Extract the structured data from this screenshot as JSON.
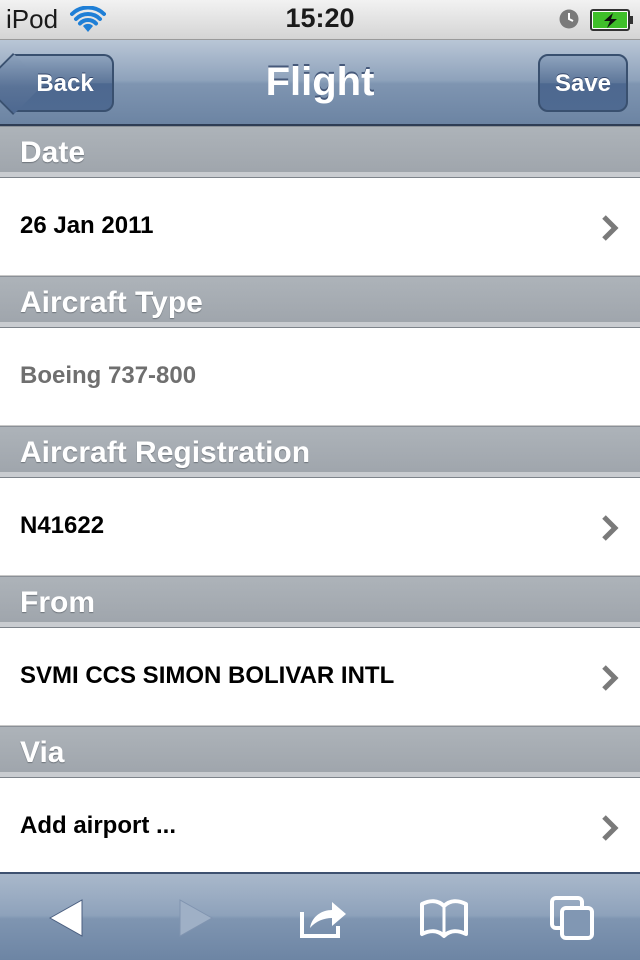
{
  "status_bar": {
    "carrier": "iPod",
    "time": "15:20",
    "icons": [
      "wifi-icon",
      "alarm-icon",
      "battery-charging-icon"
    ]
  },
  "nav_bar": {
    "title": "Flight",
    "back_label": "Back",
    "save_label": "Save"
  },
  "sections": [
    {
      "header": "Date",
      "value": "26 Jan 2011",
      "disclosure": true,
      "muted": false
    },
    {
      "header": "Aircraft Type",
      "value": "Boeing 737-800",
      "disclosure": false,
      "muted": true
    },
    {
      "header": "Aircraft Registration",
      "value": "N41622",
      "disclosure": true,
      "muted": false
    },
    {
      "header": "From",
      "value": "SVMI CCS SIMON BOLIVAR INTL",
      "disclosure": true,
      "muted": false
    },
    {
      "header": "Via",
      "value": "Add airport ...",
      "disclosure": true,
      "muted": false
    }
  ],
  "toolbar": {
    "buttons": [
      "back-arrow-icon",
      "forward-arrow-icon",
      "share-icon",
      "bookmarks-icon",
      "pages-icon"
    ],
    "forward_enabled": false
  },
  "colors": {
    "nav_blue": "#7f95b1",
    "section_header_gray": "#a4aab0",
    "muted_text": "#6f6f6f"
  }
}
